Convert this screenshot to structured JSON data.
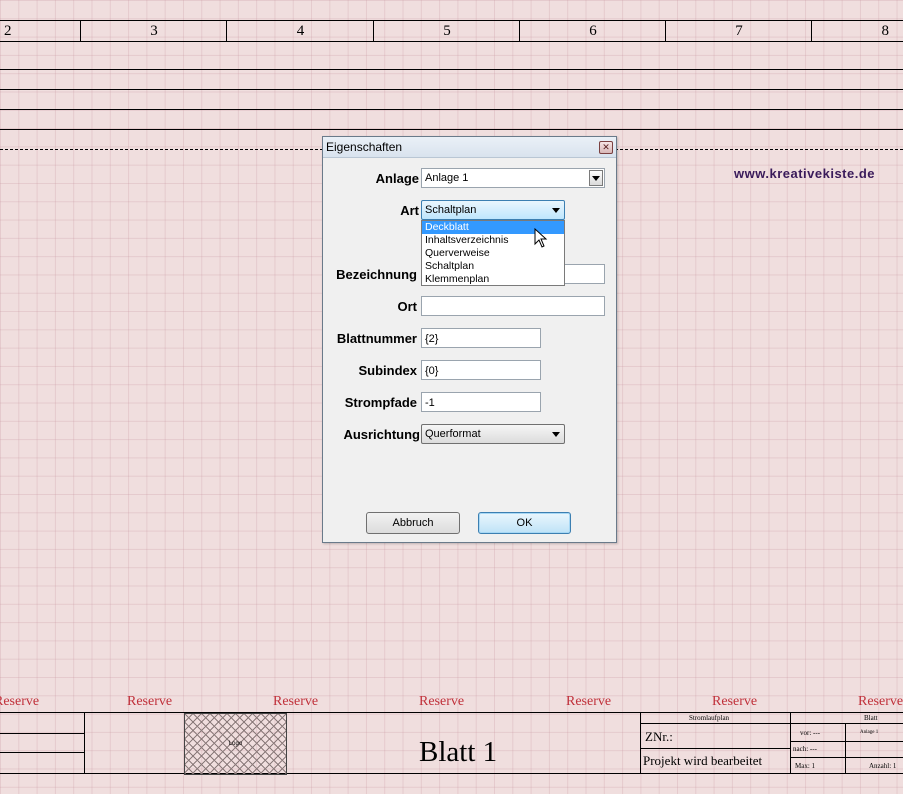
{
  "ruler": {
    "labels": [
      "2",
      "3",
      "4",
      "5",
      "6",
      "7",
      "8"
    ]
  },
  "brand": {
    "text": "www.kreativekiste.de"
  },
  "reserve": {
    "labels": [
      "Reserve",
      "Reserve",
      "Reserve",
      "Reserve",
      "Reserve",
      "Reserve",
      "Reserve"
    ]
  },
  "title_block": {
    "logo": "Logo",
    "sheet_title": "Blatt 1",
    "plan_type": "Stromlaufplan",
    "blatt_header": "Blatt",
    "znr": "ZNr.:",
    "project": "Projekt wird bearbeitet",
    "vor": "vor:  ---",
    "nach": "nach:  ---",
    "max": "Max:  1",
    "anlage": "Anlage 1",
    "anzahl": "Anzahl: 1"
  },
  "dialog": {
    "title": "Eigenschaften",
    "close_glyph": "✕",
    "fields": {
      "anlage": {
        "label": "Anlage",
        "value": "Anlage 1"
      },
      "art": {
        "label": "Art",
        "value": "Schaltplan"
      },
      "bezeichnung": {
        "label": "Bezeichnung",
        "value": ""
      },
      "ort": {
        "label": "Ort",
        "value": ""
      },
      "blattnummer": {
        "label": "Blattnummer",
        "value": "{2}"
      },
      "subindex": {
        "label": "Subindex",
        "value": "{0}"
      },
      "strompfade": {
        "label": "Strompfade",
        "value": "-1"
      },
      "ausrichtung": {
        "label": "Ausrichtung",
        "value": "Querformat"
      }
    },
    "art_options": [
      "Deckblatt",
      "Inhaltsverzeichnis",
      "Querverweise",
      "Schaltplan",
      "Klemmenplan"
    ],
    "art_highlighted": "Deckblatt",
    "buttons": {
      "cancel": "Abbruch",
      "ok": "OK"
    }
  },
  "colors": {
    "background": "#f0dede",
    "reserve": "#c0303a",
    "brand": "#3a1a5a",
    "highlight": "#3399ff"
  }
}
